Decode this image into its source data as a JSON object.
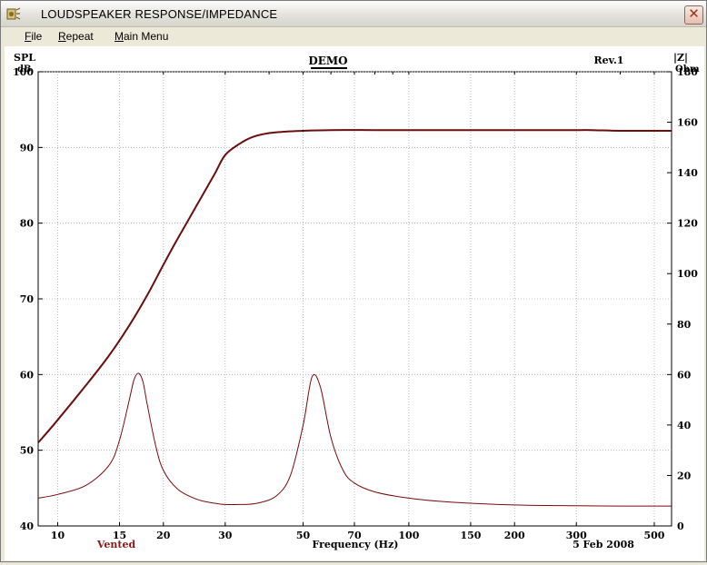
{
  "window": {
    "title": "LOUDSPEAKER RESPONSE/IMPEDANCE",
    "close_glyph": "✕"
  },
  "menu": [
    {
      "label": "File",
      "accel": "F",
      "rest": "ile"
    },
    {
      "label": "Repeat",
      "accel": "R",
      "rest": "epeat"
    },
    {
      "label": "Main Menu",
      "accel": "M",
      "rest": "ain Menu"
    }
  ],
  "chart_data": {
    "type": "line",
    "title": "DEMO",
    "revision": "Rev.1",
    "xlabel": "Frequency (Hz)",
    "x_scale": "log",
    "xlim": [
      8.8,
      560
    ],
    "x_ticks": [
      10,
      15,
      20,
      30,
      50,
      70,
      100,
      150,
      200,
      300,
      500
    ],
    "ylabel_left": [
      "SPL",
      "dB"
    ],
    "ylim_left": [
      40,
      100
    ],
    "y_ticks_left": [
      40,
      50,
      60,
      70,
      80,
      90,
      100
    ],
    "ylabel_right": [
      "|Z|",
      "Ohm"
    ],
    "ylim_right": [
      0,
      180
    ],
    "y_ticks_right": [
      0,
      20,
      40,
      60,
      80,
      100,
      120,
      140,
      160,
      180
    ],
    "grid": true,
    "footer_left": "Vented",
    "footer_right": "5 Feb 2008",
    "colors": {
      "spl": "#6b0e0e",
      "impedance": "#7a0a0a",
      "footer_left": "#8b1a1a"
    },
    "series": [
      {
        "axis": "left",
        "x": [
          8.8,
          10,
          12,
          14,
          16,
          18,
          20,
          22,
          25,
          28,
          30,
          33,
          36,
          40,
          45,
          50,
          60,
          80,
          100,
          150,
          200,
          300,
          330,
          400,
          500,
          560
        ],
        "y": [
          51.0,
          54.0,
          58.5,
          62.5,
          66.5,
          70.5,
          74.5,
          78.0,
          82.5,
          86.5,
          89.0,
          90.5,
          91.4,
          91.9,
          92.1,
          92.2,
          92.3,
          92.3,
          92.3,
          92.3,
          92.3,
          92.3,
          92.3,
          92.2,
          92.2,
          92.2
        ]
      },
      {
        "axis": "right",
        "x": [
          8.8,
          10,
          12,
          14,
          15,
          16,
          16.5,
          17,
          17.5,
          18,
          19,
          20,
          22,
          25,
          28,
          30,
          33,
          37,
          42,
          46,
          50,
          53,
          56,
          60,
          65,
          70,
          80,
          100,
          130,
          200,
          300,
          400,
          560
        ],
        "y": [
          11.0,
          12.5,
          16.0,
          24.0,
          34.0,
          50.0,
          58.0,
          60.5,
          57.0,
          48.0,
          32.0,
          22.0,
          14.5,
          10.5,
          9.0,
          8.5,
          8.5,
          9.0,
          12.0,
          20.0,
          40.0,
          59.0,
          55.0,
          35.0,
          22.0,
          17.0,
          13.5,
          11.0,
          9.5,
          8.3,
          8.0,
          7.9,
          7.9
        ]
      }
    ]
  }
}
